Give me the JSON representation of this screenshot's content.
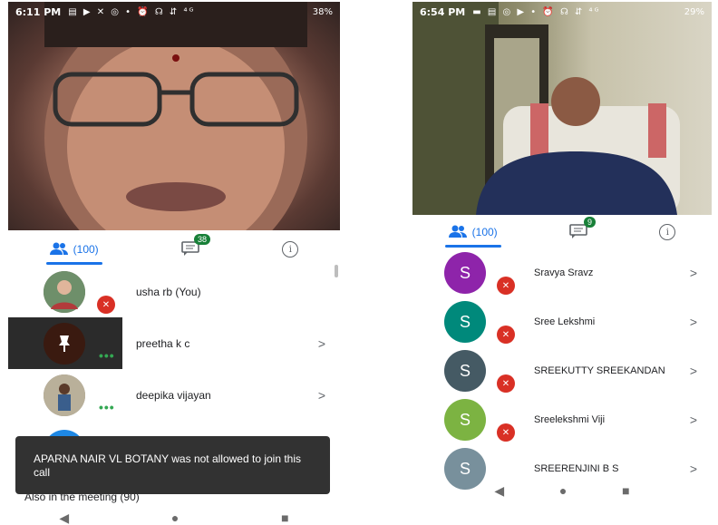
{
  "left": {
    "status": {
      "time": "6:11 PM",
      "icons": "▤ ▶ ✕ ◎ •   ⏰ ☊ ⇵ ⁴ᴳ",
      "battery": "38%"
    },
    "tabs": {
      "people_count": "(100)",
      "chat_badge": "38"
    },
    "participants": [
      {
        "name": "usha rb (You)",
        "avatar_color": "#7b6b5a"
      },
      {
        "name": "preetha k c",
        "avatar_color": "#3a1a10"
      },
      {
        "name": "deepika vijayan",
        "avatar_color": "#8a8170"
      }
    ],
    "toast": "APARNA NAIR VL BOTANY was not allowed to join this call",
    "also_in_meeting": "Also in the meeting (90)"
  },
  "right": {
    "status": {
      "time": "6:54 PM",
      "icons": "▬ ▤ ◎ ▶ •   ⏰ ☊ ⇵ ⁴ᴳ",
      "battery": "29%"
    },
    "tabs": {
      "people_count": "(100)",
      "chat_badge": "9"
    },
    "participants": [
      {
        "name": "Sravya Sravz",
        "initial": "S",
        "avatar_color": "#8e24aa"
      },
      {
        "name": "Sree Lekshmi",
        "initial": "S",
        "avatar_color": "#00897b"
      },
      {
        "name": "SREEKUTTY SREEKANDAN",
        "initial": "S",
        "avatar_color": "#455a64"
      },
      {
        "name": "Sreelekshmi Viji",
        "initial": "S",
        "avatar_color": "#7cb342"
      },
      {
        "name": "SREERENJINI B S",
        "initial": "S",
        "avatar_color": "#78909c"
      }
    ]
  }
}
